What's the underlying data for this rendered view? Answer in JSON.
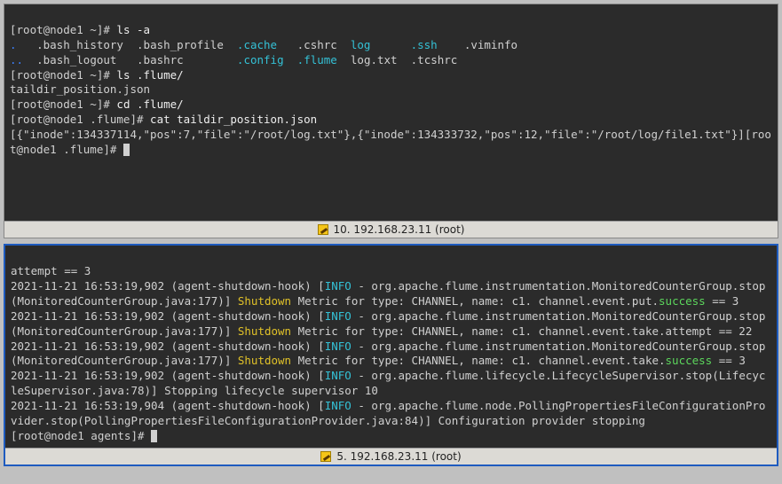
{
  "top": {
    "status_label": "10. 192.168.23.11 (root)",
    "p1_prompt": "[root@node1 ~]# ",
    "p1_cmd_a": "ls ",
    "p1_cmd_b": "-a",
    "ls_r1_a": ".",
    "ls_r1_b": ".bash_history",
    "ls_r1_c": ".bash_profile",
    "ls_r1_d": ".cache",
    "ls_r1_e": ".cshrc",
    "ls_r1_f": "log",
    "ls_r1_g": ".ssh",
    "ls_r1_h": ".viminfo",
    "ls_r2_a": "..",
    "ls_r2_b": ".bash_logout",
    "ls_r2_c": ".bashrc",
    "ls_r2_d": ".config",
    "ls_r2_e": ".flume",
    "ls_r2_f": "log.txt",
    "ls_r2_g": ".tcshrc",
    "p2_cmd": "ls .flume/",
    "p2_out": "taildir_position.json",
    "p3_cmd": "cd .flume/",
    "p4_prompt": "[root@node1 .flume]# ",
    "p4_cmd": "cat taildir_position.json",
    "p4_out": "[{\"inode\":134337114,\"pos\":7,\"file\":\"/root/log.txt\"},{\"inode\":134333732,\"pos\":12,\"file\":\"/root/log/file1.txt\"}]"
  },
  "bottom": {
    "status_label": "5. 192.168.23.11 (root)",
    "l0": "attempt == 3",
    "ts": "2021-11-21 16:53:19,902 (agent-shutdown-hook) [",
    "ts2": "2021-11-21 16:53:19,904 (agent-shutdown-hook) [",
    "info": "INFO",
    "seg_a": " - org.apache.flume.instrumentation.MonitoredCounterGroup.stop(MonitoredCounterGroup.java:177)] ",
    "shutdown": "Shutdown",
    "m1_tail": " Metric for type: CHANNEL, name: c1. channel.event.put.",
    "success": "success",
    "eq3": " == 3",
    "m2_tail": " Metric for type: CHANNEL, name: c1. channel.event.take.attempt == 22",
    "m3_tail": " Metric for type: CHANNEL, name: c1. channel.event.take.",
    "l_life": " - org.apache.flume.lifecycle.LifecycleSupervisor.stop(LifecycleSupervisor.java:78)] Stopping lifecycle supervisor 10",
    "l_poll": " - org.apache.flume.node.PollingPropertiesFileConfigurationProvider.stop(PollingPropertiesFileConfigurationProvider.java:84)] Configuration provider stopping",
    "prompt": "[root@node1 agents]# "
  }
}
